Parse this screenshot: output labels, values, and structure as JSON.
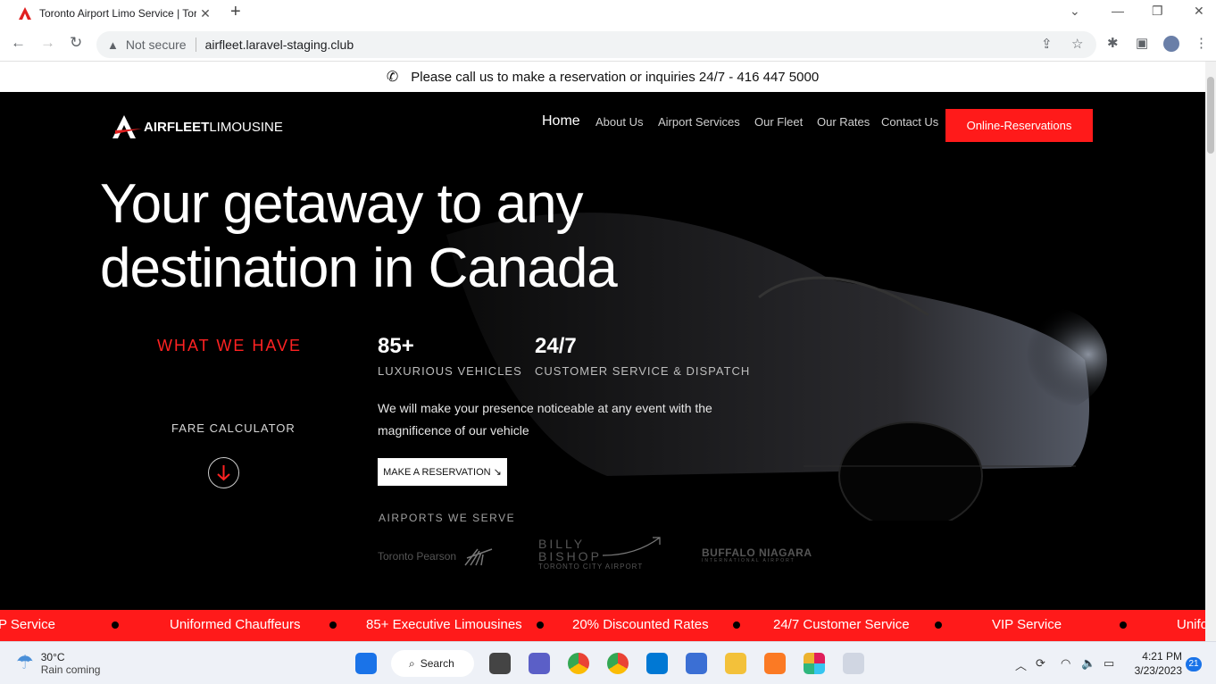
{
  "browser": {
    "tab_title": "Toronto Airport Limo Service | Toro",
    "security_label": "Not secure",
    "url": "airfleet.laravel-staging.club"
  },
  "topbar": {
    "message": "Please call us to make a reservation or inquiries 24/7 - 416 447 5000"
  },
  "nav": {
    "logo_bold": "AIRFLEET",
    "logo_light": "LIMOUSINE",
    "items": [
      "Home",
      "About Us",
      "Airport Services",
      "Our Fleet",
      "Our Rates",
      "Contact Us"
    ],
    "cta": "Online-Reservations"
  },
  "hero": {
    "headline_line1": "Your getaway to any",
    "headline_line2": "destination in Canada",
    "what_we_have": "WHAT WE HAVE",
    "stats": [
      {
        "value": "85+",
        "label": "LUXURIOUS VEHICLES"
      },
      {
        "value": "24/7",
        "label": "CUSTOMER SERVICE & DISPATCH"
      }
    ],
    "description": "We will make your presence noticeable at any event with the magnificence of our vehicle",
    "fare_calculator": "FARE CALCULATOR",
    "reservation_button": "MAKE A RESERVATION ↘",
    "airports_heading": "AIRPORTS WE SERVE",
    "airports": [
      "Toronto Pearson",
      "BILLY",
      "BISHOP",
      "TORONTO CITY AIRPORT",
      "BUFFALO NIAGARA",
      "INTERNATIONAL AIRPORT"
    ]
  },
  "ticker": {
    "items": [
      "P Service",
      "Uniformed Chauffeurs",
      "85+ Executive Limousines",
      "20% Discounted Rates",
      "24/7 Customer Service",
      "VIP Service",
      "Unifo"
    ]
  },
  "taskbar": {
    "temperature": "30°C",
    "condition": "Rain coming",
    "search_label": "Search",
    "time": "4:21 PM",
    "date": "3/23/2023",
    "notification_count": "21"
  },
  "colors": {
    "brand_red": "#ff1a1a",
    "hero_bg": "#000000"
  }
}
